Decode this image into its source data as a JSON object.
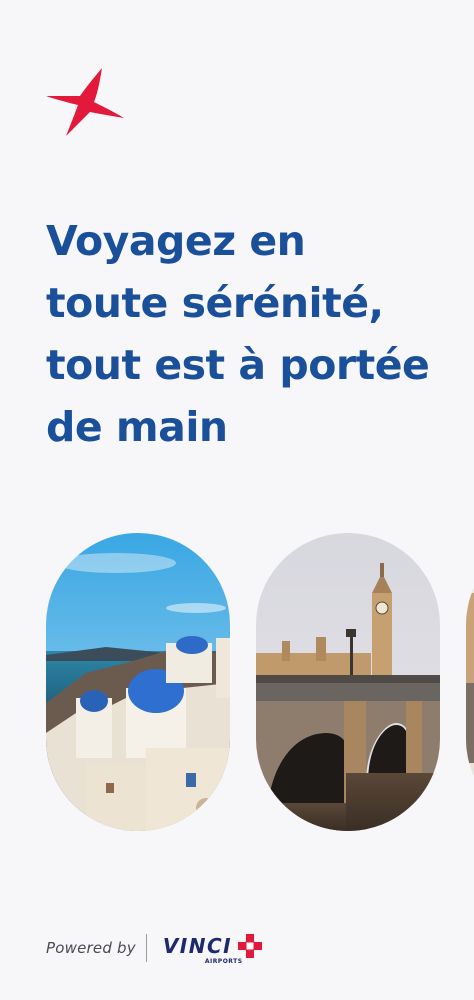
{
  "brand": {
    "logo_icon": "red-star-logo",
    "accent_color": "#e2193a",
    "headline_color": "#1a4f9a"
  },
  "headline": {
    "lines": [
      "Voyagez en",
      "toute sérénité,",
      "tout est à portée",
      "de main"
    ]
  },
  "destinations": [
    {
      "name": "santorini-image"
    },
    {
      "name": "london-westminster-image"
    },
    {
      "name": "partial-destination-image"
    }
  ],
  "footer": {
    "powered_by": "Powered by",
    "partner_name": "VINCI",
    "partner_sub": "AIRPORTS",
    "partner_color": "#1f2a6e"
  }
}
